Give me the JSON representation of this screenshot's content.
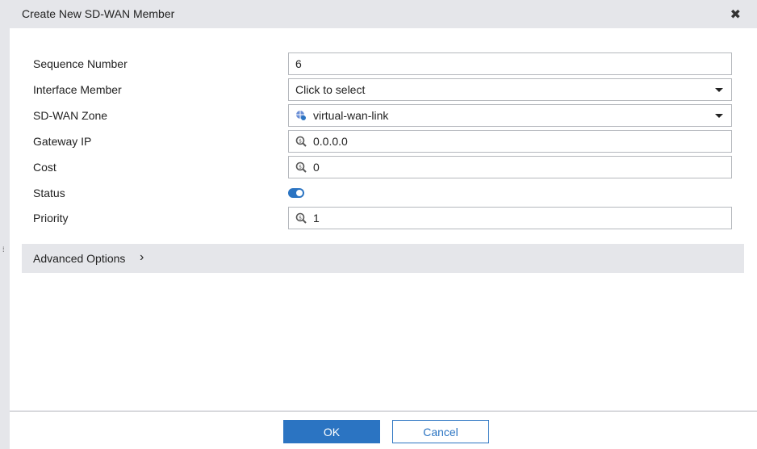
{
  "dialog": {
    "title": "Create New SD-WAN Member"
  },
  "form": {
    "sequence_number": {
      "label": "Sequence Number",
      "value": "6"
    },
    "interface_member": {
      "label": "Interface Member",
      "value": "Click to select"
    },
    "sdwan_zone": {
      "label": "SD-WAN Zone",
      "value": "virtual-wan-link"
    },
    "gateway_ip": {
      "label": "Gateway IP",
      "value": "0.0.0.0"
    },
    "cost": {
      "label": "Cost",
      "value": "0"
    },
    "status": {
      "label": "Status",
      "enabled": true
    },
    "priority": {
      "label": "Priority",
      "value": "1"
    }
  },
  "advanced": {
    "label": "Advanced Options"
  },
  "footer": {
    "ok": "OK",
    "cancel": "Cancel"
  },
  "colors": {
    "accent": "#2b74c2"
  }
}
